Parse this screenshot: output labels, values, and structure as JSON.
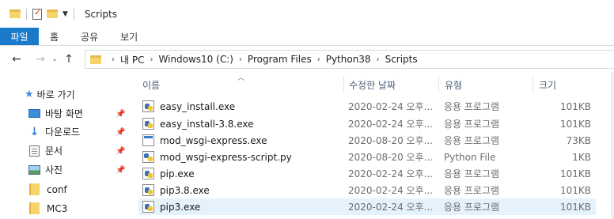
{
  "window": {
    "title": "Scripts"
  },
  "ribbon": {
    "tabs": [
      "파일",
      "홈",
      "공유",
      "보기"
    ]
  },
  "address": {
    "crumbs": [
      "내 PC",
      "Windows10 (C:)",
      "Program Files",
      "Python38",
      "Scripts"
    ]
  },
  "sidebar": {
    "quick_access": "바로 가기",
    "items": [
      {
        "label": "바탕 화면",
        "icon": "desktop-icon",
        "pinned": true
      },
      {
        "label": "다운로드",
        "icon": "download-icon",
        "pinned": true
      },
      {
        "label": "문서",
        "icon": "documents-icon",
        "pinned": true
      },
      {
        "label": "사진",
        "icon": "pictures-icon",
        "pinned": true
      },
      {
        "label": "conf",
        "icon": "folder-icon",
        "pinned": false
      },
      {
        "label": "MC3",
        "icon": "folder-icon",
        "pinned": false
      }
    ]
  },
  "columns": {
    "name": "이름",
    "date": "수정한 날짜",
    "type": "유형",
    "size": "크기"
  },
  "files": [
    {
      "name": "easy_install.exe",
      "date": "2020-02-24 오후...",
      "type": "응용 프로그램",
      "size": "101KB",
      "icon": "exe"
    },
    {
      "name": "easy_install-3.8.exe",
      "date": "2020-02-24 오후...",
      "type": "응용 프로그램",
      "size": "101KB",
      "icon": "exe"
    },
    {
      "name": "mod_wsgi-express.exe",
      "date": "2020-08-20 오후...",
      "type": "응용 프로그램",
      "size": "73KB",
      "icon": "win"
    },
    {
      "name": "mod_wsgi-express-script.py",
      "date": "2020-08-20 오후...",
      "type": "Python File",
      "size": "1KB",
      "icon": "py"
    },
    {
      "name": "pip.exe",
      "date": "2020-02-24 오후...",
      "type": "응용 프로그램",
      "size": "101KB",
      "icon": "exe"
    },
    {
      "name": "pip3.8.exe",
      "date": "2020-02-24 오후...",
      "type": "응용 프로그램",
      "size": "101KB",
      "icon": "exe"
    },
    {
      "name": "pip3.exe",
      "date": "2020-02-24 오후...",
      "type": "응용 프로그램",
      "size": "101KB",
      "icon": "exe",
      "selected": true
    }
  ],
  "colors": {
    "accent": "#1979ca",
    "selected_row": "#e5f1fb",
    "folder": "#f5d46b"
  }
}
